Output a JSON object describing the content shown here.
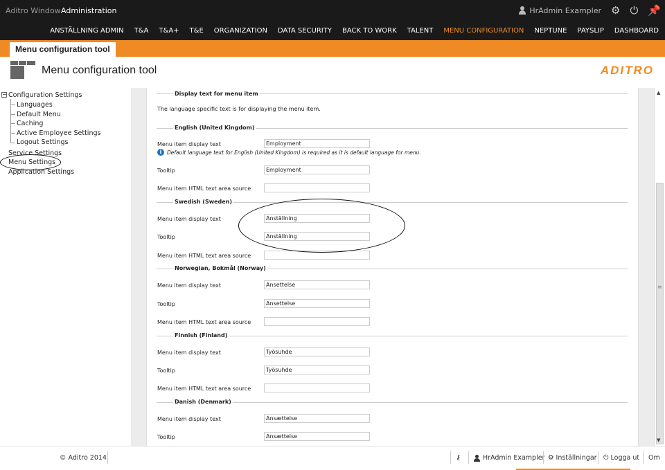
{
  "topbar": {
    "window_label": "Aditro Window",
    "section_label": "Administration",
    "user_name": "HrAdmin Exampler",
    "icons": [
      "gear-icon",
      "power-icon",
      "pin-icon"
    ]
  },
  "nav": {
    "items": [
      "ANSTÄLLNING ADMIN",
      "T&A",
      "T&A+",
      "T&E",
      "ORGANIZATION",
      "DATA SECURITY",
      "BACK TO WORK",
      "TALENT",
      "MENU CONFIGURATION",
      "NEPTUNE",
      "PAYSLIP",
      "DASHBOARD"
    ],
    "active": "MENU CONFIGURATION"
  },
  "tab": {
    "label": "Menu configuration tool"
  },
  "header": {
    "title": "Menu configuration tool",
    "brand": "ADITRO"
  },
  "colors": {
    "accent": "#f08a24",
    "topbar": "#1a1a1a",
    "info": "#1e73be"
  },
  "sidebar": {
    "root": "Configuration Settings",
    "children": [
      "Languages",
      "Default Menu",
      "Caching",
      "Active Employee Settings",
      "Logout Settings"
    ],
    "others": [
      "Service Settings",
      "Menu Settings",
      "Application Settings"
    ],
    "selected": "Menu Settings"
  },
  "main": {
    "section_title": "Display text for menu item",
    "description": "The language specific text is for displaying the menu item.",
    "field_labels": {
      "display": "Menu item display text",
      "tooltip": "Tooltip",
      "html": "Menu item HTML text area source"
    },
    "info_note": "Default language text for English (United Kingdom) is required as it is default language for menu.",
    "languages": [
      {
        "name": "English (United Kingdom)",
        "display": "Employment",
        "tooltip": "Employment",
        "html": ""
      },
      {
        "name": "Swedish (Sweden)",
        "display": "Anställning",
        "tooltip": "Anställning",
        "html": ""
      },
      {
        "name": "Norwegian, Bokmål (Norway)",
        "display": "Ansettelse",
        "tooltip": "Ansettelse",
        "html": ""
      },
      {
        "name": "Finnish (Finland)",
        "display": "Työsuhde",
        "tooltip": "Työsuhde",
        "html": ""
      },
      {
        "name": "Danish (Denmark)",
        "display": "Ansættelse",
        "tooltip": "Ansættelse",
        "html": ""
      }
    ]
  },
  "footer": {
    "copyright": "© Aditro 2014",
    "user": "HrAdmin Exampler",
    "settings": "Inställningar",
    "logout": "Logga ut",
    "about": "Om"
  }
}
